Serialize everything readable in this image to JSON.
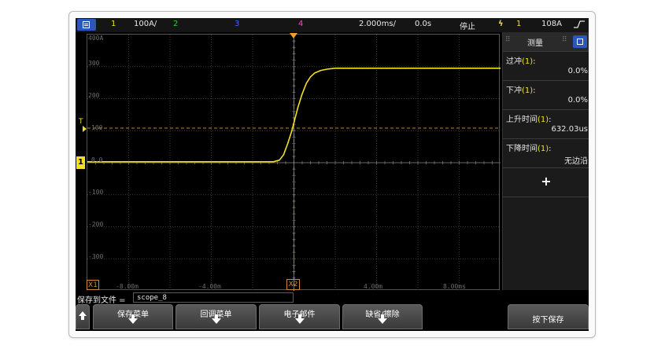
{
  "topbar": {
    "ch1_num": "1",
    "ch1_scale": "100A/",
    "ch2_num": "2",
    "ch3_num": "3",
    "ch4_num": "4",
    "timebase": "2.000ms/",
    "delay": "0.0s",
    "run_state": "停止",
    "trig_source": "1",
    "trig_level": "108A"
  },
  "colors": {
    "ch1": "#f0e020",
    "ch2": "#33cc33",
    "ch3": "#3a6cff",
    "ch4": "#ff44cc",
    "accent": "#2b58b8"
  },
  "graticule": {
    "y_labels": [
      "400A",
      "300",
      "200",
      "100",
      "0.0",
      "-100",
      "-200",
      "-300"
    ],
    "x_labels": [
      "-8.00m",
      "-4.00m",
      "4.00m",
      "8.00ms"
    ],
    "x1_label": "X1",
    "x2_label": "X2",
    "trig_level_marker": "T",
    "ch1_marker": "1"
  },
  "measurements": {
    "title": "测量",
    "items": [
      {
        "name": "过冲",
        "source": "(1)",
        "colon": ":",
        "value": "0.0%"
      },
      {
        "name": "下冲",
        "source": "(1)",
        "colon": ":",
        "value": "0.0%"
      },
      {
        "name": "上升时间",
        "source": "(1)",
        "colon": ":",
        "value": "632.03us"
      },
      {
        "name": "下降时间",
        "source": "(1)",
        "colon": ":",
        "value": "无边沿"
      }
    ],
    "add_label": "+"
  },
  "save_file": {
    "label": "保存到文件 =",
    "value": "scope_8"
  },
  "softkeys": {
    "save_menu": "保存菜单",
    "recall_menu": "回调菜单",
    "email": "电子邮件",
    "default_erase": "缺省/擦除",
    "press_save": "按下保存"
  },
  "chart_data": {
    "type": "line",
    "title": "",
    "xlabel": "",
    "ylabel": "",
    "xlim": [
      -10,
      10
    ],
    "ylim": [
      -400,
      400
    ],
    "x_unit": "ms",
    "y_unit": "A",
    "x": [
      -10,
      -1.0,
      -0.7,
      -0.5,
      -0.3,
      -0.1,
      0.0,
      0.2,
      0.4,
      0.6,
      0.8,
      1.0,
      1.3,
      1.6,
      2.0,
      3.0,
      6.0,
      10.0
    ],
    "series": [
      {
        "values": [
          3,
          3,
          8,
          25,
          60,
          100,
          125,
          175,
          215,
          248,
          268,
          280,
          288,
          292,
          295,
          295,
          295,
          295
        ]
      }
    ]
  }
}
